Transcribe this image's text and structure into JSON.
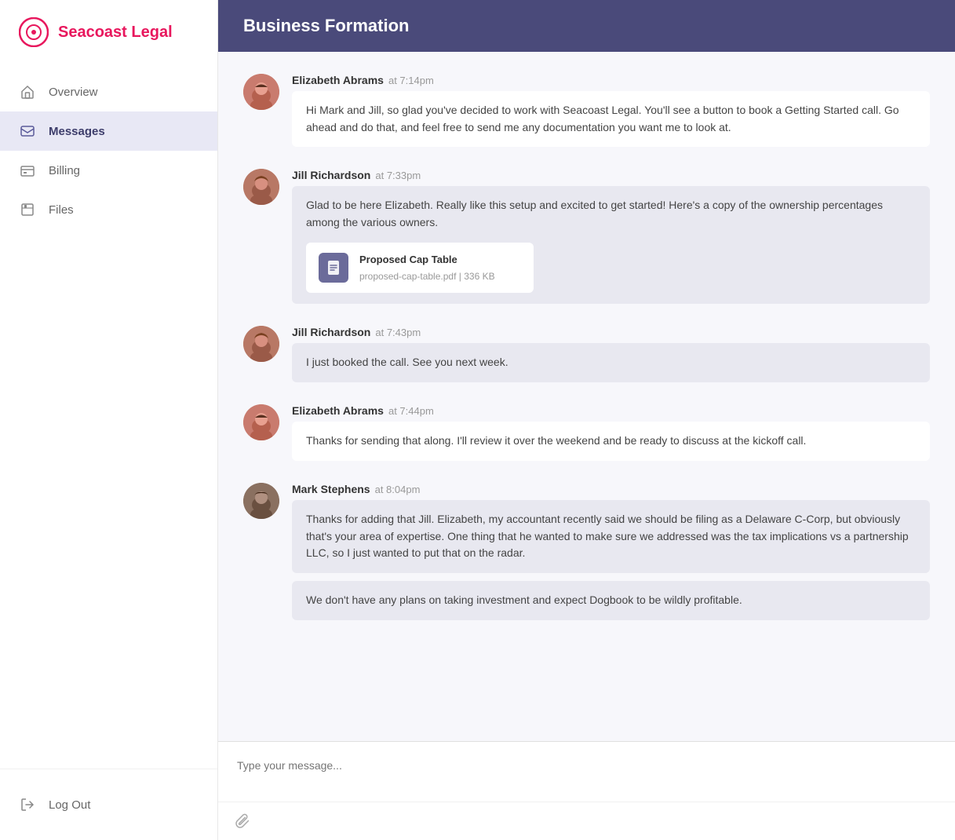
{
  "brand": {
    "name": "Seacoast Legal"
  },
  "sidebar": {
    "nav_items": [
      {
        "id": "overview",
        "label": "Overview",
        "active": false
      },
      {
        "id": "messages",
        "label": "Messages",
        "active": true
      },
      {
        "id": "billing",
        "label": "Billing",
        "active": false
      },
      {
        "id": "files",
        "label": "Files",
        "active": false
      }
    ],
    "logout_label": "Log Out"
  },
  "header": {
    "title": "Business Formation"
  },
  "messages": [
    {
      "id": 1,
      "author": "Elizabeth Abrams",
      "time": "at 7:14pm",
      "avatar_type": "ea",
      "text": "Hi Mark and Jill, so glad you've decided to work with Seacoast Legal. You'll see a button to book a Getting Started call. Go ahead and do that, and feel free to send me any documentation you want me to look at.",
      "bubble_style": "white"
    },
    {
      "id": 2,
      "author": "Jill Richardson",
      "time": "at 7:33pm",
      "avatar_type": "jr",
      "text": "Glad to be here Elizabeth. Really like this setup and excited to get started! Here's a copy of the ownership percentages among the various owners.",
      "bubble_style": "gray",
      "attachment": {
        "name": "Proposed Cap Table",
        "filename": "proposed-cap-table.pdf",
        "size": "336 KB"
      }
    },
    {
      "id": 3,
      "author": "Jill Richardson",
      "time": "at 7:43pm",
      "avatar_type": "jr",
      "text": "I just booked the call. See you next week.",
      "bubble_style": "gray"
    },
    {
      "id": 4,
      "author": "Elizabeth Abrams",
      "time": "at 7:44pm",
      "avatar_type": "ea",
      "text": "Thanks for sending that along. I'll review it over the weekend and be ready to discuss at the kickoff call.",
      "bubble_style": "white"
    },
    {
      "id": 5,
      "author": "Mark Stephens",
      "time": "at 8:04pm",
      "avatar_type": "ms",
      "text": "Thanks for adding that Jill. Elizabeth, my accountant recently said we should be filing as a Delaware C-Corp, but obviously that's your area of expertise. One thing that he wanted to make sure we addressed was the tax implications vs a partnership LLC, so I just wanted to put that on the radar.",
      "text2": "We don't have any plans on taking investment and expect Dogbook to be wildly profitable.",
      "bubble_style": "gray"
    }
  ],
  "input": {
    "placeholder": "Type your message..."
  }
}
